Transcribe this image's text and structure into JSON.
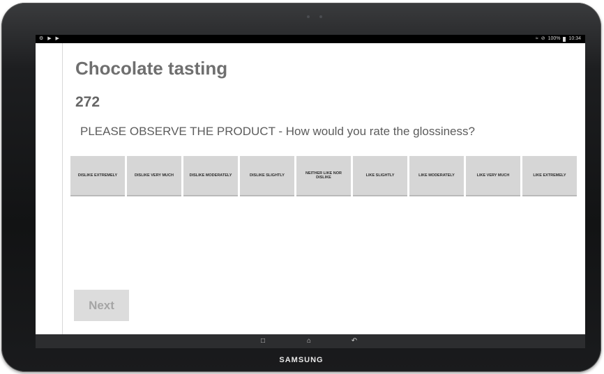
{
  "status_bar": {
    "left_icons": "⚙ ▶ ▶",
    "right_text": "100%",
    "time": "10:34"
  },
  "app": {
    "title": "Chocolate tasting",
    "sample_code": "272",
    "question": "PLEASE OBSERVE THE PRODUCT - How would you rate the glossiness?",
    "scale_options": [
      "DISLIKE EXTREMELY",
      "DISLIKE VERY MUCH",
      "DISLIKE MODERATELY",
      "DISLIKE SLIGHTLY",
      "NEITHER LIKE NOR DISLIKE",
      "LIKE SLIGHTLY",
      "LIKE MODERATELY",
      "LIKE VERY MUCH",
      "LIKE EXTREMELY"
    ],
    "next_label": "Next"
  },
  "device": {
    "brand": "SAMSUNG"
  }
}
